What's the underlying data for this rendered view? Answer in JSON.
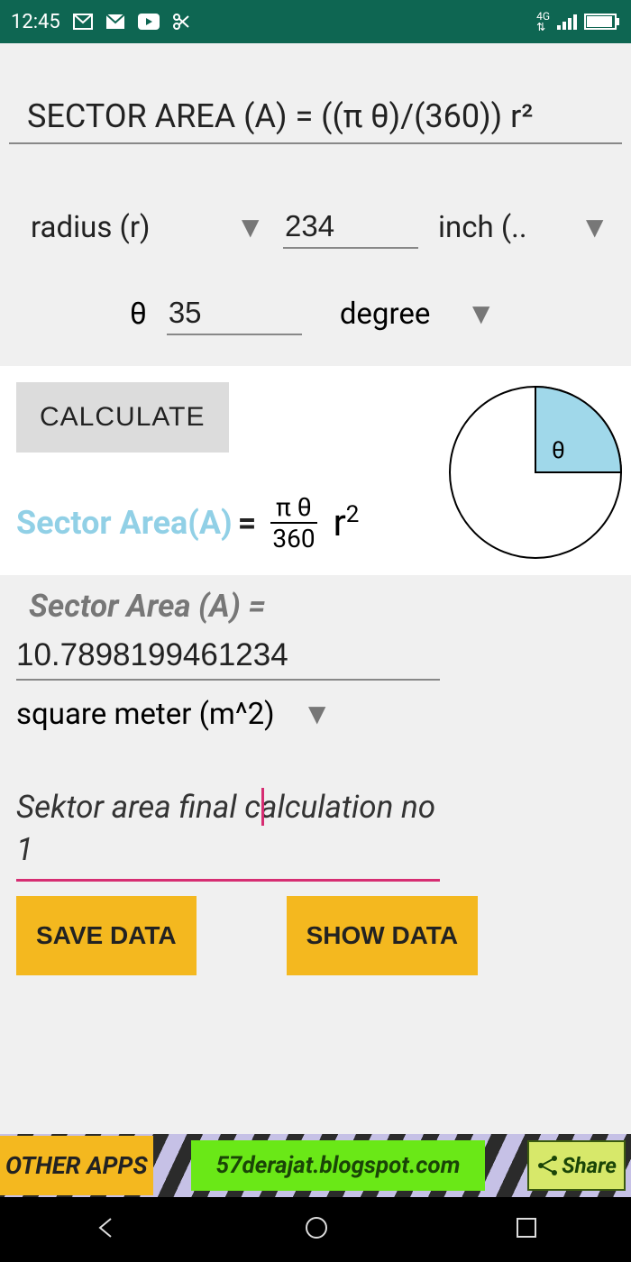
{
  "status": {
    "time": "12:45",
    "network": "4G"
  },
  "formula_title": "SECTOR AREA (A) = ((π θ)/(360)) r²",
  "inputs": {
    "radius_label": "radius (r)",
    "radius_value": "234",
    "radius_unit": "inch (..",
    "theta_label": "θ",
    "theta_value": "35",
    "theta_unit": "degree"
  },
  "calculate_label": "CALCULATE",
  "formula_render": {
    "sector_area": "Sector Area(A)",
    "pi_theta": "π θ",
    "denom": "360",
    "r2": "r",
    "diagram_theta": "θ"
  },
  "result": {
    "label": "Sector  Area (A) =",
    "value": "10.7898199461234",
    "unit": "square meter (m^2)"
  },
  "note_value": "Sektor area final calculation no 1",
  "buttons": {
    "save": "SAVE DATA",
    "show": "SHOW DATA"
  },
  "bottom": {
    "other_apps": "OTHER APPS",
    "blog": "57derajat.blogspot.com",
    "share": "Share"
  }
}
